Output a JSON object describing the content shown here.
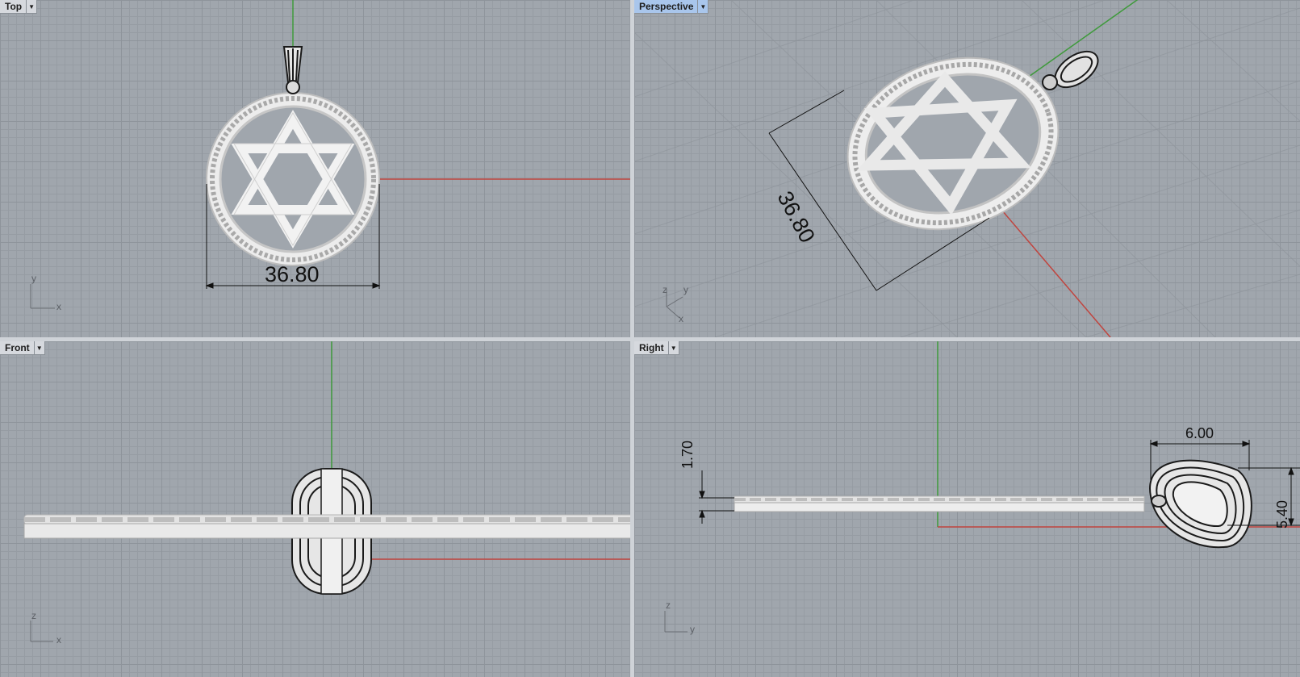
{
  "viewports": {
    "top": {
      "label": "Top",
      "dimension": "36.80",
      "axis_a": "y",
      "axis_b": "x"
    },
    "perspective": {
      "label": "Perspective",
      "dimension": "36.80",
      "axis_a": "z",
      "axis_b": "y",
      "axis_c": "x"
    },
    "front": {
      "label": "Front",
      "axis_a": "z",
      "axis_b": "x"
    },
    "right": {
      "label": "Right",
      "dim_thickness": "1.70",
      "dim_bail_width": "6.00",
      "dim_bail_height": "5.40",
      "axis_a": "z",
      "axis_b": "y"
    }
  },
  "icons": {
    "dropdown": "chevron-down-icon"
  },
  "colors": {
    "x_axis": "#c0453f",
    "y_axis": "#3f9a3c",
    "active_tab": "#a9c6ec",
    "background": "#a0a6ad"
  }
}
